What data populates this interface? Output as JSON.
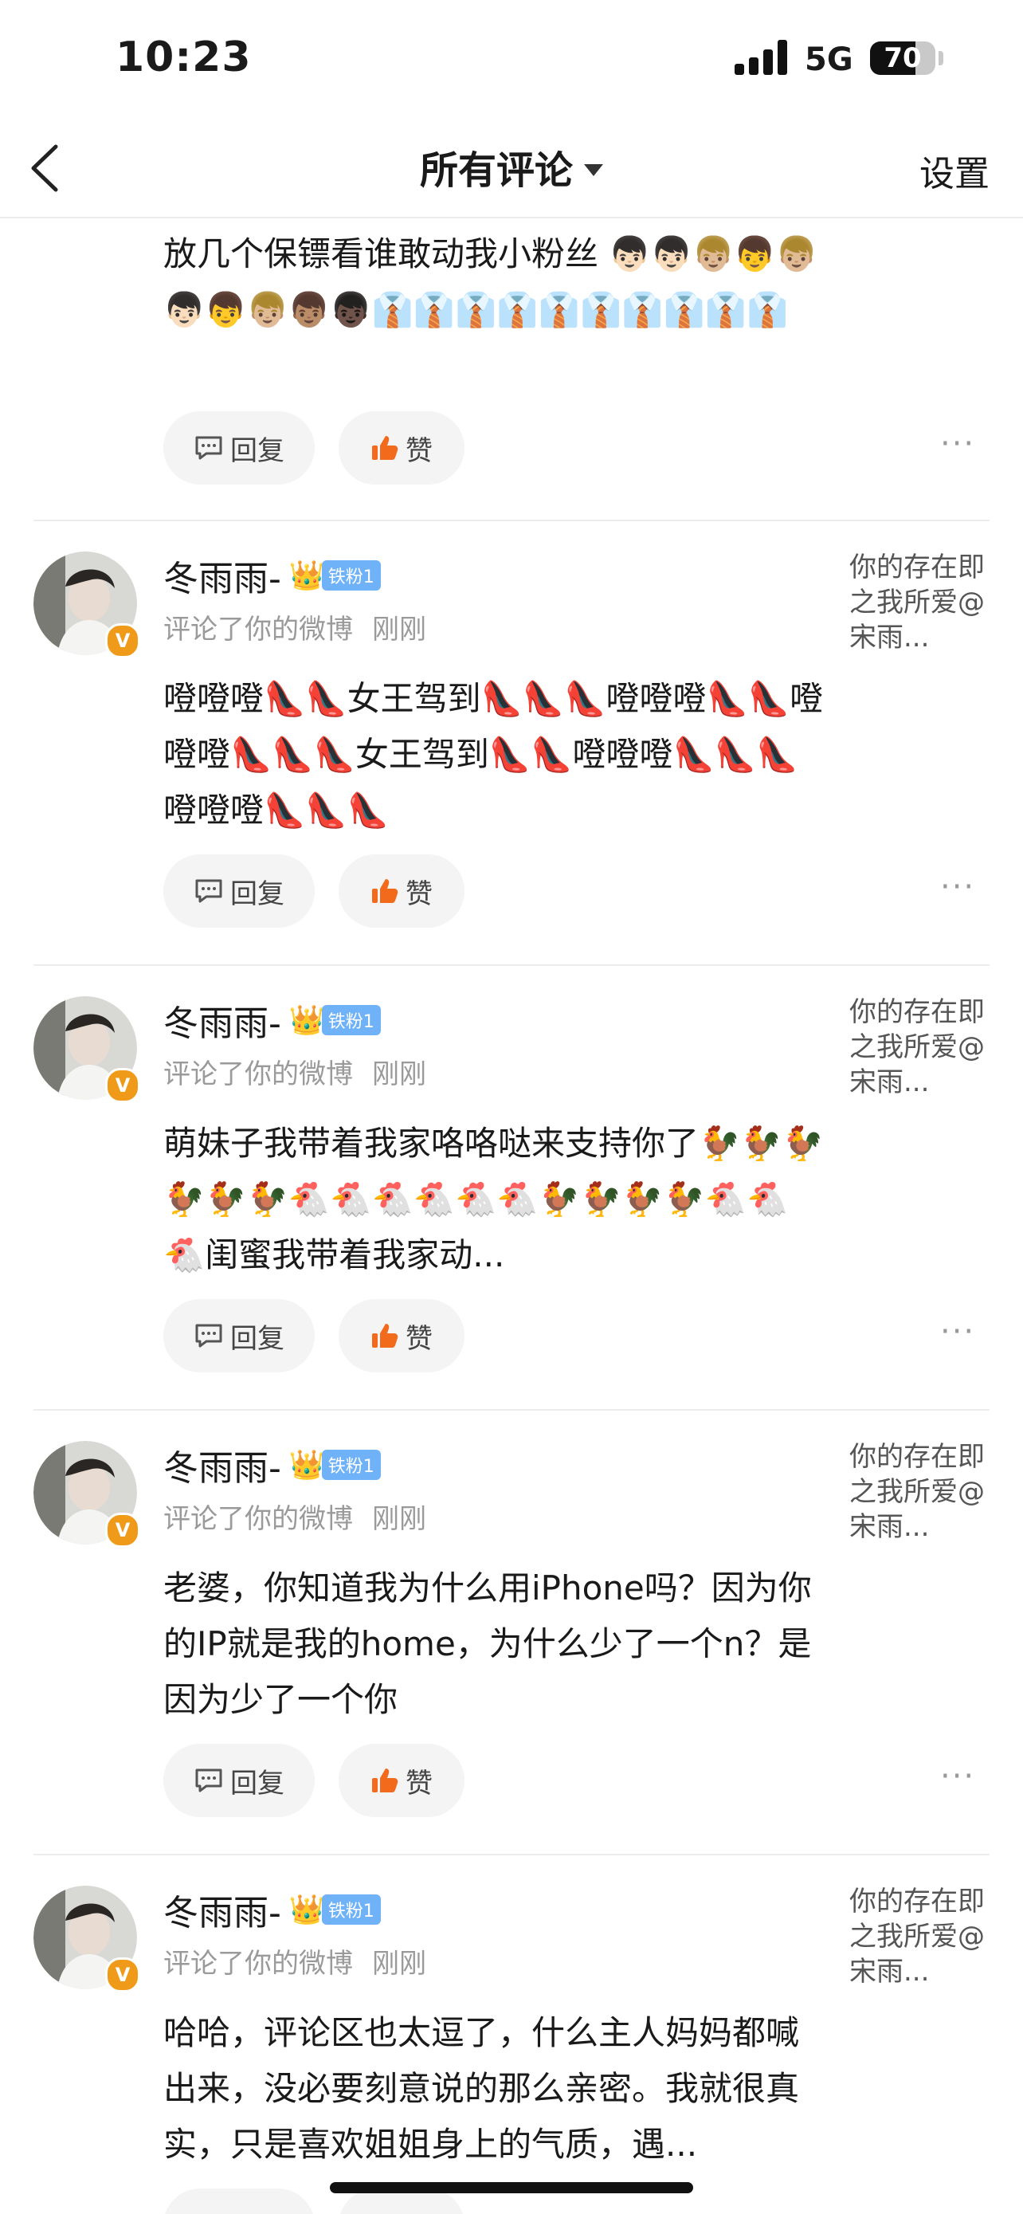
{
  "status_bar": {
    "time": "10:23",
    "network": "5G",
    "battery": "70",
    "battery_level": 0.7
  },
  "nav": {
    "title": "所有评论",
    "settings": "设置"
  },
  "labels": {
    "reply": "回复",
    "like": "赞",
    "more": "···"
  },
  "colors": {
    "fan_badge": "#6fb2f7",
    "verified": "#f09a1a",
    "like_icon": "#f26b1d"
  },
  "comments": [
    {
      "text": "放几个保镖看谁敢动我小粉丝 👦🏻👦🏻👦🏼👦👦🏼👦🏻👦👦🏼👦🏽👦🏿👔👔👔👔👔👔👔👔👔👔"
    },
    {
      "name": "冬雨雨-",
      "fan_badge": "铁粉1",
      "action": "评论了你的微博",
      "time": "刚刚",
      "quote": "你的存在即之我所爱@宋雨...",
      "text": "噔噔噔👠👠女王驾到👠👠👠噔噔噔👠👠噔噔噔👠👠👠女王驾到👠👠噔噔噔👠👠👠噔噔噔👠👠👠"
    },
    {
      "name": "冬雨雨-",
      "fan_badge": "铁粉1",
      "action": "评论了你的微博",
      "time": "刚刚",
      "quote": "你的存在即之我所爱@宋雨...",
      "text": "萌妹子我带着我家咯咯哒来支持你了🐓🐓🐓🐓🐓🐓🐔🐔🐔🐔🐔🐔🐓🐓🐓🐓🐔🐔🐔闺蜜我带着我家动..."
    },
    {
      "name": "冬雨雨-",
      "fan_badge": "铁粉1",
      "action": "评论了你的微博",
      "time": "刚刚",
      "quote": "你的存在即之我所爱@宋雨...",
      "text": "老婆，你知道我为什么用iPhone吗？因为你的IP就是我的home，为什么少了一个n？是因为少了一个你"
    },
    {
      "name": "冬雨雨-",
      "fan_badge": "铁粉1",
      "action": "评论了你的微博",
      "time": "刚刚",
      "quote": "你的存在即之我所爱@宋雨...",
      "text": "哈哈，评论区也太逗了，什么主人妈妈都喊出来，没必要刻意说的那么亲密。我就很真实，只是喜欢姐姐身上的气质，遇..."
    }
  ]
}
